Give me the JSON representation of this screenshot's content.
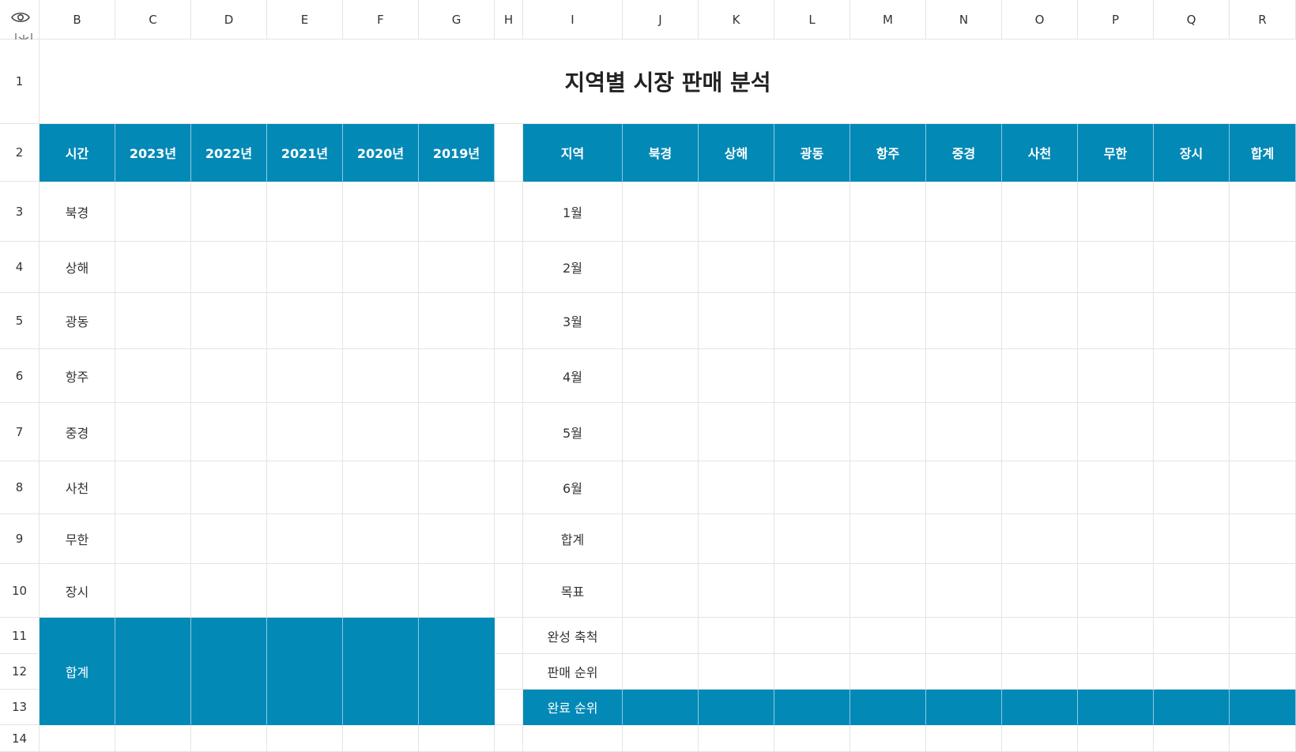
{
  "title": "지역별 시장 판매 분석",
  "columns": [
    "B",
    "C",
    "D",
    "E",
    "F",
    "G",
    "H",
    "I",
    "J",
    "K",
    "L",
    "M",
    "N",
    "O",
    "P",
    "Q",
    "R"
  ],
  "rows": [
    "1",
    "2",
    "3",
    "4",
    "5",
    "6",
    "7",
    "8",
    "9",
    "10",
    "11",
    "12",
    "13",
    "14"
  ],
  "left_table": {
    "header": [
      "시간",
      "2023년",
      "2022년",
      "2021년",
      "2020년",
      "2019년"
    ],
    "regions": [
      "북경",
      "상해",
      "광동",
      "항주",
      "중경",
      "사천",
      "무한",
      "장시"
    ],
    "total_label": "합계"
  },
  "right_table": {
    "header": [
      "지역",
      "북경",
      "상해",
      "광동",
      "항주",
      "중경",
      "사천",
      "무한",
      "장시",
      "합계"
    ],
    "row_labels": [
      "1월",
      "2월",
      "3월",
      "4월",
      "5월",
      "6월",
      "합계",
      "목표",
      "완성 축척",
      "판매 순위",
      "완료 순위"
    ]
  },
  "colors": {
    "accent": "#0389b6",
    "grid": "#e4e4e4"
  },
  "icons": {
    "visibility": "eye-icon",
    "freeze": "freeze-pane-icon"
  }
}
